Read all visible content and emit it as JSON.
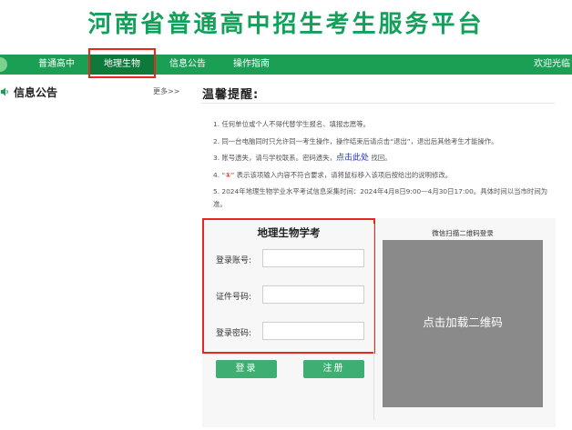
{
  "site": {
    "title": "河南省普通高中招生考生服务平台"
  },
  "nav": {
    "items": [
      {
        "label": "普通高中"
      },
      {
        "label": "地理生物"
      },
      {
        "label": "信息公告"
      },
      {
        "label": "操作指南"
      }
    ],
    "active_index": 1,
    "welcome": "欢迎光临"
  },
  "notice": {
    "title": "信息公告",
    "more": "更多>>"
  },
  "tips": {
    "title": "温馨提醒:",
    "items": [
      "1. 任何单位或个人不得代替学生报名、填报志愿等。",
      "2. 同一台电脑同时只允许同一考生操作，操作结束后请点击“退出”，退出后其他考生才能操作。",
      "3. 账号遗失，请与学校联系。密码遗失，",
      "4. “",
      "5. 2024年地理生物学业水平考试信息采集时间：2024年4月8日9:00—4月30日17:00。具体时间以当市时间为准。"
    ],
    "item3_link": "点击此处",
    "item3_suffix": " 找回。",
    "item4_mark": "①",
    "item4_text": "” 表示该项输入内容不符合要求，请将鼠标移入该项后按给出的说明修改。"
  },
  "login": {
    "title": "地理生物学考",
    "account_label": "登录账号:",
    "id_label": "证件号码:",
    "password_label": "登录密码:",
    "account_value": "",
    "id_value": "",
    "password_value": "",
    "login_button": "登录",
    "register_button": "注册"
  },
  "qr": {
    "caption": "微信扫描二维码登录",
    "load_text": "点击加载二维码"
  },
  "colors": {
    "brand_green": "#1a9f55",
    "title_green": "#13a05a",
    "active_nav": "#0d7a3c",
    "button_green": "#3fae73",
    "highlight_red": "#e8281f",
    "link_blue": "#2233cc",
    "qr_gray": "#8a8a8a"
  },
  "icons": {
    "notice": "speaker-icon",
    "nav_logo": "leaf-icon"
  }
}
